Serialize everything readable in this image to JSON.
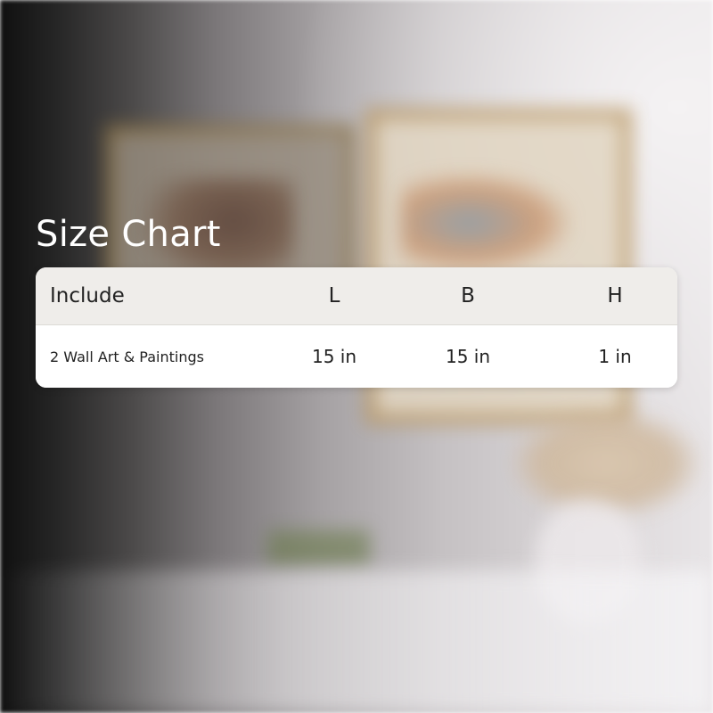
{
  "title": "Size Chart",
  "table": {
    "headers": [
      "Include",
      "L",
      "B",
      "H"
    ],
    "rows": [
      [
        "2 Wall Art & Paintings",
        "15 in",
        "15 in",
        "1 in"
      ]
    ]
  }
}
